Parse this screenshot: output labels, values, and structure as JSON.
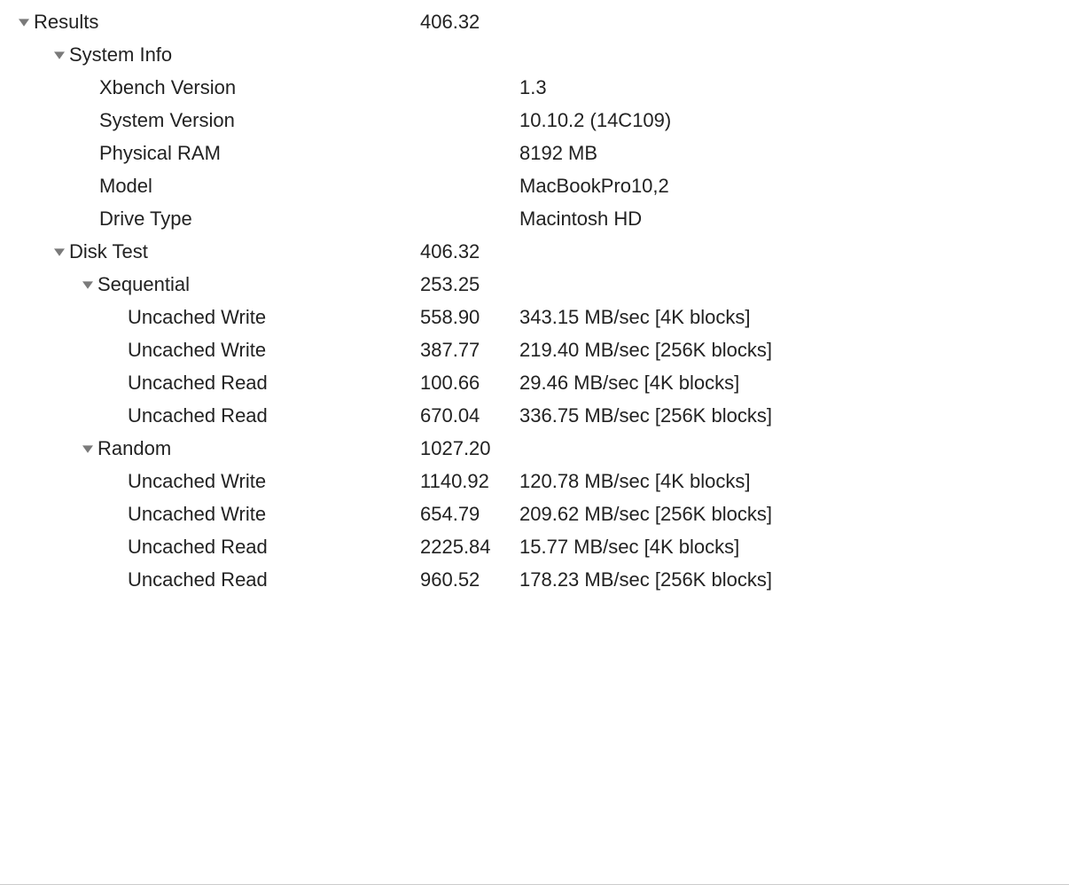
{
  "results": {
    "label": "Results",
    "score": "406.32"
  },
  "system_info": {
    "label": "System Info",
    "items": [
      {
        "label": "Xbench Version",
        "value": "1.3"
      },
      {
        "label": "System Version",
        "value": "10.10.2 (14C109)"
      },
      {
        "label": "Physical RAM",
        "value": "8192 MB"
      },
      {
        "label": "Model",
        "value": "MacBookPro10,2"
      },
      {
        "label": "Drive Type",
        "value": "Macintosh HD"
      }
    ]
  },
  "disk_test": {
    "label": "Disk Test",
    "score": "406.32",
    "sequential": {
      "label": "Sequential",
      "score": "253.25",
      "items": [
        {
          "label": "Uncached Write",
          "score": "558.90",
          "detail": "343.15 MB/sec [4K blocks]"
        },
        {
          "label": "Uncached Write",
          "score": "387.77",
          "detail": "219.40 MB/sec [256K blocks]"
        },
        {
          "label": "Uncached Read",
          "score": "100.66",
          "detail": "29.46 MB/sec [4K blocks]"
        },
        {
          "label": "Uncached Read",
          "score": "670.04",
          "detail": "336.75 MB/sec [256K blocks]"
        }
      ]
    },
    "random": {
      "label": "Random",
      "score": "1027.20",
      "items": [
        {
          "label": "Uncached Write",
          "score": "1140.92",
          "detail": "120.78 MB/sec [4K blocks]"
        },
        {
          "label": "Uncached Write",
          "score": "654.79",
          "detail": "209.62 MB/sec [256K blocks]"
        },
        {
          "label": "Uncached Read",
          "score": "2225.84",
          "detail": "15.77 MB/sec [4K blocks]"
        },
        {
          "label": "Uncached Read",
          "score": "960.52",
          "detail": "178.23 MB/sec [256K blocks]"
        }
      ]
    }
  }
}
